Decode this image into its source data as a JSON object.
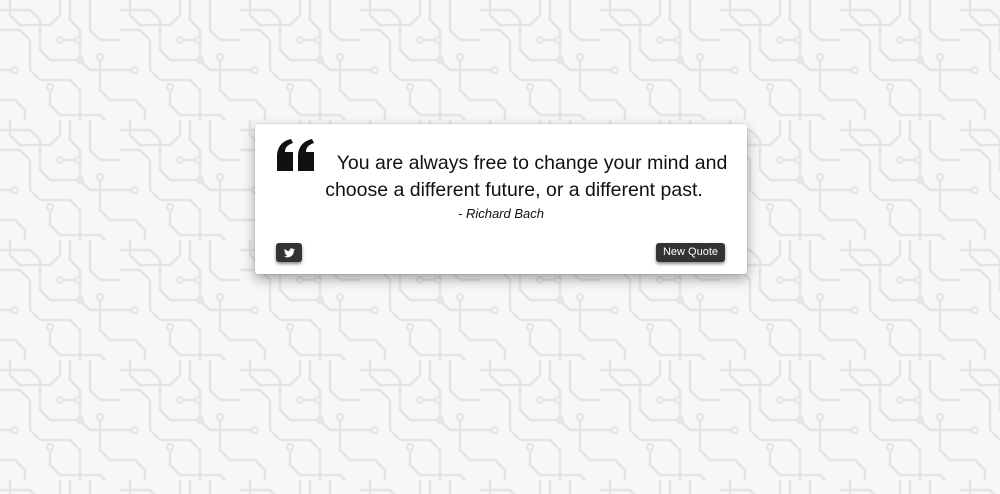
{
  "page": {
    "background_color": "#f6f6f6",
    "pattern_color": "#e6e6e6"
  },
  "quote_card": {
    "icon": "quote-left-icon",
    "text": "You are always free to change your mind and choose a different future, or a different past.",
    "author": "- Richard Bach"
  },
  "buttons": {
    "tweet_icon": "twitter-icon",
    "new_quote_label": "New Quote",
    "color": "#333333"
  }
}
